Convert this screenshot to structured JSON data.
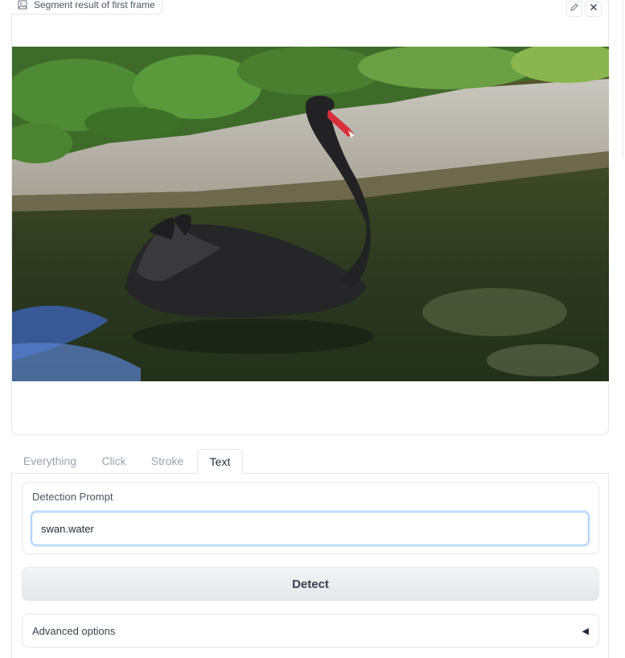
{
  "image_panel": {
    "label": "Segment result of first frame",
    "label_icon": "image-icon",
    "edit_icon": "pencil-icon",
    "close_icon": "close-icon"
  },
  "tabs": [
    {
      "label": "Everything",
      "active": false
    },
    {
      "label": "Click",
      "active": false
    },
    {
      "label": "Stroke",
      "active": false
    },
    {
      "label": "Text",
      "active": true
    }
  ],
  "detection": {
    "label": "Detection Prompt",
    "value": "swan.water"
  },
  "detect_button": {
    "label": "Detect"
  },
  "advanced": {
    "label": "Advanced options",
    "caret": "◀",
    "caret_icon": "triangle-left-icon"
  },
  "colors": {
    "input_focus": "#93c5fd",
    "border": "#e5e7eb"
  }
}
